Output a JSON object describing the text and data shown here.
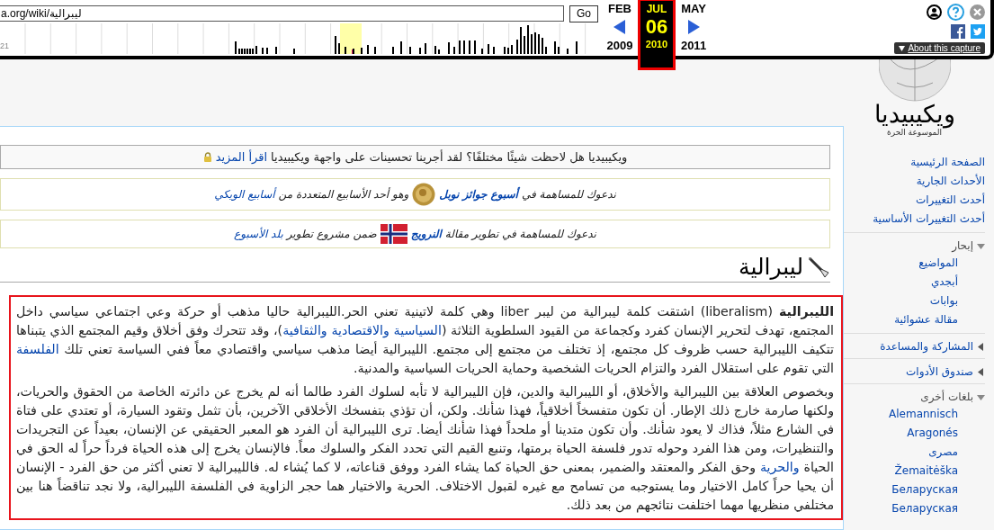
{
  "wayback": {
    "url": "a.org/wiki/ليبرالية",
    "go_label": "Go",
    "timeline_label": "21",
    "months": [
      {
        "label": "MAY",
        "selected": false
      },
      {
        "label": "JUL",
        "selected": true
      },
      {
        "label": "FEB",
        "selected": false
      }
    ],
    "day": "06",
    "years": [
      {
        "label": "2011",
        "selected": false
      },
      {
        "label": "2010",
        "selected": true
      },
      {
        "label": "2009",
        "selected": false
      }
    ],
    "about": "About this capture"
  },
  "notices": [
    {
      "kind": "plain",
      "segments": [
        {
          "kind": "text",
          "text": "ويكيبيديا هل لاحظت شيئًا مختلفًا؟ لقد أجرينا تحسينات على واجهة ويكيبيديا"
        },
        {
          "kind": "link",
          "text": "اقرأ المزيد"
        },
        {
          "kind": "lock"
        }
      ]
    },
    {
      "kind": "italic",
      "segments": [
        {
          "kind": "text",
          "text": "ندعوك للمساهمة في"
        },
        {
          "kind": "strong-link",
          "text": "أسبوع جوائز نوبل"
        },
        {
          "kind": "medal"
        },
        {
          "kind": "text",
          "text": "وهو أحد الأسابيع المتعددة من"
        },
        {
          "kind": "link",
          "text": "أسابيع الويكي"
        }
      ]
    },
    {
      "kind": "italic",
      "segments": [
        {
          "kind": "text",
          "text": "ندعوك للمساهمة في تطوير مقالة"
        },
        {
          "kind": "strong-link",
          "text": "النرويج"
        },
        {
          "kind": "flag"
        },
        {
          "kind": "text",
          "text": "ضمن مشروع تطوير"
        },
        {
          "kind": "link",
          "text": "بلد الأسبوع"
        }
      ]
    }
  ],
  "article": {
    "title": "ليبرالية",
    "paragraphs": [
      [
        {
          "kind": "bold",
          "text": "الليبرالية"
        },
        {
          "kind": "text",
          "text": " (liberalism) اشتقت كلمة ليبرالية من ليبر liber وهي كلمة لاتينية تعني الحر.الليبرالية حاليا مذهب أو حركة وعي اجتماعي سياسي داخل المجتمع، تهدف لتحرير الإنسان كفرد وكجماعة من القيود السلطوية الثلاثة ("
        },
        {
          "kind": "link",
          "text": "السياسية والاقتصادية والثقافية"
        },
        {
          "kind": "text",
          "text": ")، وقد تتحرك وفق أخلاق وقيم المجتمع الذي يتبناها تتكيف الليبرالية حسب ظروف كل مجتمع، إذ تختلف من مجتمع إلى مجتمع. الليبرالية أيضا مذهب سياسي واقتصادي معاً ففي السياسة تعني تلك "
        },
        {
          "kind": "link",
          "text": "الفلسفة"
        },
        {
          "kind": "text",
          "text": " التي تقوم على استقلال الفرد والتزام الحريات الشخصية وحماية الحريات السياسية والمدنية."
        }
      ],
      [
        {
          "kind": "text",
          "text": "وبخصوص العلاقة بين الليبرالية والأخلاق، أو الليبرالية والدين، فإن الليبرالية لا تأبه لسلوك الفرد طالما أنه لم يخرج عن دائرته الخاصة من الحقوق والحريات، ولكنها صارمة خارج ذلك الإطار. أن تكون متفسخاً أخلاقياً، فهذا شأنك. ولكن، أن تؤذي بتفسخك الأخلاقي الآخرين، بأن تثمل وتقود السيارة، أو تعتدي على فتاة في الشارع مثلاً، فذاك لا يعود شأنك. وأن تكون متدينا أو ملحداً فهذا شأنك أيضا. ترى الليبرالية أن الفرد هو المعبر الحقيقي عن الإنسان، بعيداً عن التجريدات والتنظيرات، ومن هذا الفرد وحوله تدور فلسفة الحياة برمتها، وتنبع القيم التي تحدد الفكر والسلوك معاً. فالإنسان يخرج إلى هذه الحياة فرداً حراً له الحق في الحياة "
        },
        {
          "kind": "link",
          "text": "والحرية"
        },
        {
          "kind": "text",
          "text": " وحق الفكر والمعتقد والضمير، بمعنى حق الحياة كما يشاء الفرد ووفق قناعاته، لا كما يُشاء له. فالليبرالية لا تعني أكثر من حق الفرد - الإنسان أن يحيا حراً كامل الاختيار وما يستوجبه من تسامح مع غيره لقبول الاختلاف. الحرية والاختيار هما حجر الزاوية في الفلسفة الليبرالية، ولا نجد تناقضاً هنا بين مختلفي منظريها مهما اختلفت نتائجهم من بعد ذلك."
        }
      ]
    ]
  },
  "sidebar": {
    "wordmark": "ويكيبيديا",
    "tagline": "الموسوعة الحرة",
    "nav": [
      "الصفحة الرئيسية",
      "الأحداث الجارية",
      "أحدث التغييرات",
      "أحدث التغييرات الأساسية"
    ],
    "sections": [
      {
        "title": "إبحار",
        "expanded": true,
        "items": [
          "المواضيع",
          "أبجدي",
          "بوابات",
          "مقالة عشوائية"
        ]
      },
      {
        "title": "المشاركة والمساعدة",
        "expanded": false
      },
      {
        "title": "صندوق الأدوات",
        "expanded": false
      },
      {
        "title": "بلغات أخرى",
        "expanded": true,
        "items": [
          "Alemannisch",
          "Aragonés",
          "مصرى",
          "Žemaitėška",
          "Беларуская",
          "Беларуская"
        ]
      }
    ]
  }
}
